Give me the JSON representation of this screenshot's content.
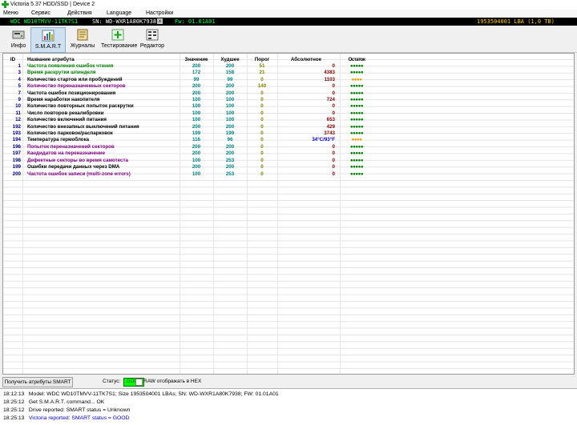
{
  "window": {
    "title": "Victoria 5.37 HDD/SSD | Device 2"
  },
  "menu": [
    "Меню",
    "Сервис",
    "Действия",
    "Language",
    "Настройки"
  ],
  "drive": {
    "model": "WDC WD10TMVV-11TK7S1",
    "serial": "SN: WD-WXR1A80K7938",
    "sep": "x",
    "fw": "Fw: 01.01A01",
    "lba": "1953504001 LBA (1,0 TB)"
  },
  "toolbar": [
    {
      "label": "Инфо",
      "icon": "drive-info-icon"
    },
    {
      "label": "S.M.A.R.T",
      "icon": "smart-chart-icon"
    },
    {
      "label": "Журналы",
      "icon": "journal-icon"
    },
    {
      "label": "Тестирование",
      "icon": "test-plus-icon"
    },
    {
      "label": "Редактор",
      "icon": "editor-icon"
    }
  ],
  "table": {
    "headers": {
      "id": "ID",
      "name": "Название атрибута",
      "value": "Значение",
      "worst": "Худшее",
      "threshold": "Порог",
      "raw": "Абсолютное",
      "health": "Остаток"
    },
    "rows": [
      {
        "id": "1",
        "name": "Частота появления ошибок чтения",
        "value": "200",
        "worst": "200",
        "threshold": "51",
        "raw": "0",
        "health": "●●●●●",
        "name_color": "#008000",
        "health_color": "#008000"
      },
      {
        "id": "3",
        "name": "Время раскрутки шпинделя",
        "value": "172",
        "worst": "158",
        "threshold": "21",
        "raw": "4383",
        "health": "●●●●●",
        "name_color": "#008000",
        "health_color": "#008000"
      },
      {
        "id": "4",
        "name": "Количество стартов или пробуждений",
        "value": "99",
        "worst": "99",
        "threshold": "0",
        "raw": "1103",
        "health": "●●●●",
        "name_color": "#000000",
        "health_color": "#f0a000"
      },
      {
        "id": "5",
        "name": "Количество переназначенных секторов",
        "value": "200",
        "worst": "200",
        "threshold": "140",
        "raw": "0",
        "health": "●●●●●",
        "name_color": "#800080",
        "health_color": "#008000"
      },
      {
        "id": "7",
        "name": "Частота ошибок позиционирования",
        "value": "200",
        "worst": "200",
        "threshold": "0",
        "raw": "0",
        "health": "●●●●●",
        "name_color": "#000000",
        "health_color": "#008000"
      },
      {
        "id": "9",
        "name": "Время наработки накопителя",
        "value": "100",
        "worst": "100",
        "threshold": "0",
        "raw": "724",
        "health": "●●●●●",
        "name_color": "#000000",
        "health_color": "#008000"
      },
      {
        "id": "10",
        "name": "Количество повторных попыток раскрутки",
        "value": "100",
        "worst": "100",
        "threshold": "0",
        "raw": "0",
        "health": "●●●●●",
        "name_color": "#000000",
        "health_color": "#008000"
      },
      {
        "id": "11",
        "name": "Число повторов рекалибровки",
        "value": "100",
        "worst": "100",
        "threshold": "0",
        "raw": "0",
        "health": "●●●●●",
        "name_color": "#000000",
        "health_color": "#008000"
      },
      {
        "id": "12",
        "name": "Количество включений питания",
        "value": "100",
        "worst": "100",
        "threshold": "0",
        "raw": "653",
        "health": "●●●●●",
        "name_color": "#000000",
        "health_color": "#008000"
      },
      {
        "id": "192",
        "name": "Количество внезапных выключений питания",
        "value": "200",
        "worst": "200",
        "threshold": "0",
        "raw": "429",
        "health": "●●●●●",
        "name_color": "#000000",
        "health_color": "#008000"
      },
      {
        "id": "193",
        "name": "Количество парковок/распарковок",
        "value": "199",
        "worst": "199",
        "threshold": "0",
        "raw": "3743",
        "health": "●●●●●",
        "name_color": "#000000",
        "health_color": "#008000"
      },
      {
        "id": "194",
        "name": "Температура гермоблока",
        "value": "116",
        "worst": "96",
        "threshold": "0",
        "raw": "34°C/93°F",
        "health": "●●●●",
        "name_color": "#000000",
        "health_color": "#f0a000",
        "raw_color": "#0000c0"
      },
      {
        "id": "196",
        "name": "Попыток переназначений секторов",
        "value": "200",
        "worst": "200",
        "threshold": "0",
        "raw": "0",
        "health": "●●●●●",
        "name_color": "#800080",
        "health_color": "#008000"
      },
      {
        "id": "197",
        "name": "Кандидатов на переназначение",
        "value": "200",
        "worst": "200",
        "threshold": "0",
        "raw": "0",
        "health": "●●●●●",
        "name_color": "#800080",
        "health_color": "#008000"
      },
      {
        "id": "198",
        "name": "Дефектные секторы во время самотеста",
        "value": "100",
        "worst": "253",
        "threshold": "0",
        "raw": "0",
        "health": "●●●●●",
        "name_color": "#800080",
        "health_color": "#008000"
      },
      {
        "id": "199",
        "name": "Ошибки передачи данных через DMA",
        "value": "200",
        "worst": "200",
        "threshold": "0",
        "raw": "0",
        "health": "●●●●●",
        "name_color": "#000000",
        "health_color": "#008000"
      },
      {
        "id": "200",
        "name": "Частота ошибок записи (multi-zone errors)",
        "value": "100",
        "worst": "253",
        "threshold": "0",
        "raw": "0",
        "health": "●●●●●",
        "name_color": "#800080",
        "health_color": "#008000"
      }
    ]
  },
  "controls": {
    "get_smart_label": "Получить атрибуты SMART",
    "status_label": "Статус:",
    "status_value": "GOOD",
    "raw_hex_label": "RAW отображать в HEX"
  },
  "log": [
    {
      "time": "18:12:13",
      "text": "Model: WDC WD10TMVV-11TK7S1; Size 1953504001 LBAs; SN: WD-WXR1A80K7938; FW: 01.01A01",
      "color": "#000000"
    },
    {
      "time": "18:25:12",
      "text": "Get S.M.A.R.T. command... OK",
      "color": "#000000"
    },
    {
      "time": "18:25:12",
      "text": "Drive reported: SMART status = Unknown",
      "color": "#000000"
    },
    {
      "time": "18:25:13",
      "text": "Victoria reported: SMART status = GOOD",
      "color": "#0000c0"
    }
  ]
}
